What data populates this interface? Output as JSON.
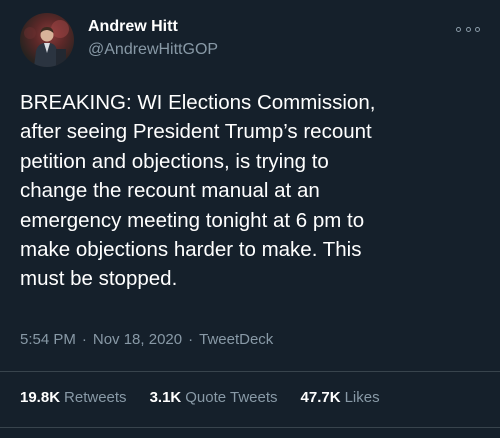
{
  "user": {
    "name": "Andrew Hitt",
    "handle": "@AndrewHittGOP",
    "avatar_icon": "profile-photo"
  },
  "more_icon": "more-options-icon",
  "tweet": {
    "text": "BREAKING: WI Elections Commission,\nafter seeing President Trump’s recount\npetition and objections, is trying to\nchange the recount manual at an\nemergency meeting tonight at 6 pm to\nmake objections harder to make. This\nmust be stopped."
  },
  "meta": {
    "time": "5:54 PM",
    "date": "Nov 18, 2020",
    "separator": "·",
    "source": "TweetDeck"
  },
  "stats": {
    "retweets_count": "19.8K",
    "retweets_label": "Retweets",
    "quotes_count": "3.1K",
    "quotes_label": "Quote Tweets",
    "likes_count": "47.7K",
    "likes_label": "Likes"
  },
  "colors": {
    "background": "#15202b",
    "text_primary": "#ffffff",
    "text_secondary": "#8899a6",
    "divider": "#38444d"
  }
}
